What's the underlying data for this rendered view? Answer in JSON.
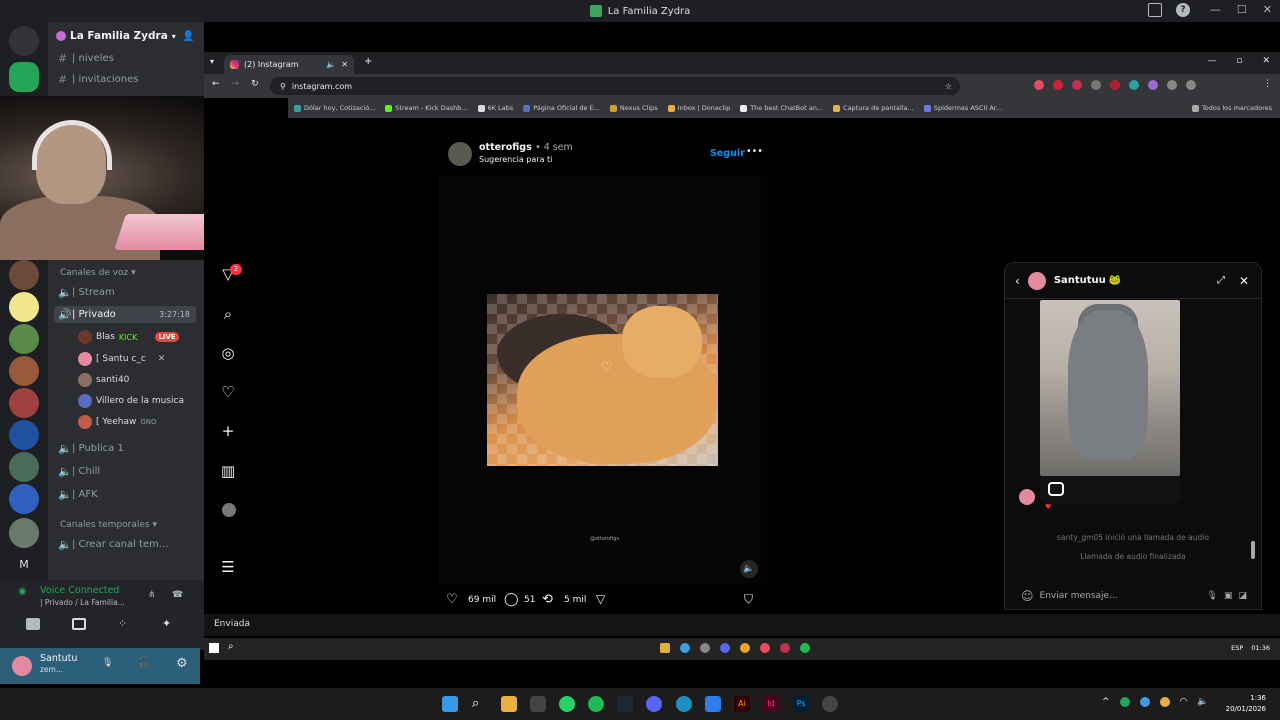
{
  "window": {
    "title": "La Familia Zydra"
  },
  "discord": {
    "server_name": "La Familia Zydra",
    "text_channels": [
      {
        "name": "| niveles"
      },
      {
        "name": "| invitaciones"
      }
    ],
    "voice_category": "Canales de voz",
    "voice_channels": [
      {
        "name": "| Stream"
      },
      {
        "name": "| Privado",
        "timer": "3:27:18"
      },
      {
        "name": "| Publica 1"
      },
      {
        "name": "| Chill"
      },
      {
        "name": "| AFK"
      }
    ],
    "members": [
      {
        "name": "Blas",
        "badge": "KICK",
        "live": "LIVE"
      },
      {
        "name": "[ Santu c_c"
      },
      {
        "name": "santi40"
      },
      {
        "name": "Villero de la musica"
      },
      {
        "name": "[ Yeehaw",
        "extra": "GNO"
      }
    ],
    "temp_category": "Canales temporales",
    "temp_channel": "| Crear canal tem...",
    "voice_status": "Voice Connected",
    "voice_sub": "| Privado / La Familia...",
    "user_name": "Santutu",
    "user_status": "zem..."
  },
  "browser": {
    "tab_title": "(2) Instagram",
    "url": "instagram.com",
    "bookmarks": [
      "Dólar hoy, Cotizació...",
      "Stream - Kick Dashb...",
      "6K Labs",
      "Página Oficial de E...",
      "Nexus Clips",
      "Inbox | Donaclip",
      "The best ChatBot an...",
      "Captura de pantalla...",
      "Spidermas ASCII Ar..."
    ],
    "all_bookmarks": "Todos los marcadores"
  },
  "instagram": {
    "nav_badge": "2",
    "post": {
      "username": "otterofigs",
      "age": "• 4 sem",
      "suggestion": "Sugerencia para ti",
      "follow_label": "Seguir",
      "watermark": "@otterofigs",
      "likes": "69 mil",
      "comments": "51",
      "reposts": "5 mil"
    },
    "dm": {
      "contact": "Santutuu",
      "contact_emoji": "🐸",
      "call_started": "santy_gm05 inició una llamada de audio",
      "call_ended": "Llamada de audio finalizada",
      "input_placeholder": "Enviar mensaje..."
    }
  },
  "status_strip": {
    "sent_label": "Enviada"
  },
  "clock": {
    "time": "1:36",
    "date": "20/01/2026"
  },
  "inner_clock": {
    "time": "01:36",
    "lang": "ESP"
  }
}
